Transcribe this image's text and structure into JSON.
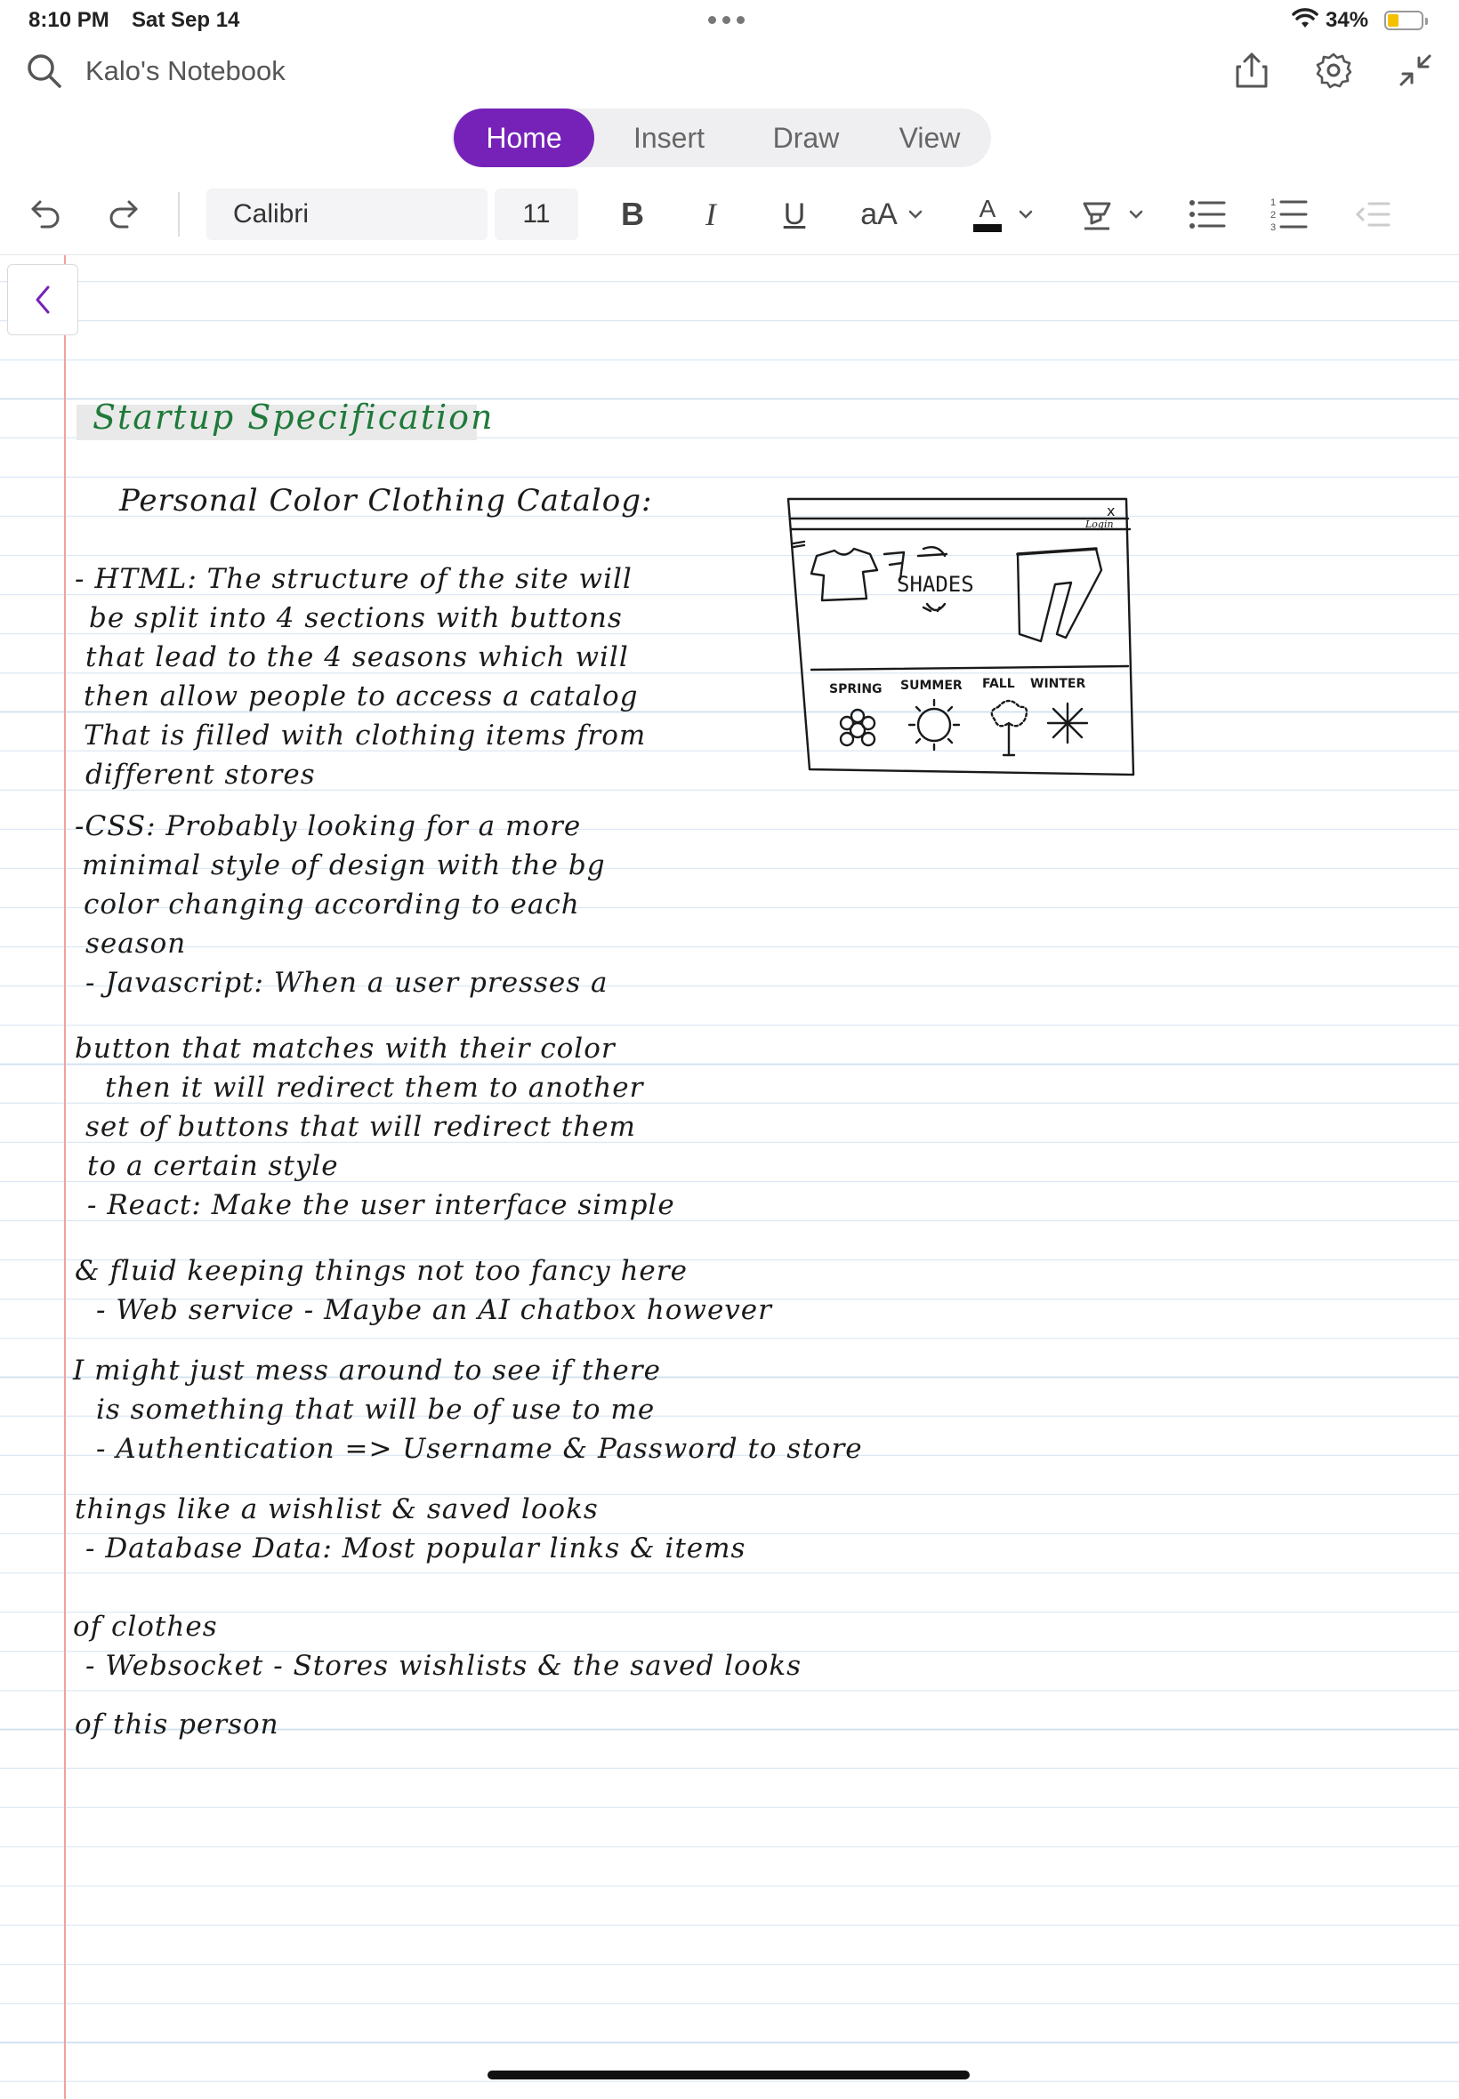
{
  "status_bar": {
    "time": "8:10 PM",
    "date": "Sat Sep 14",
    "battery": "34%"
  },
  "title_bar": {
    "notebook_name": "Kalo's Notebook"
  },
  "tabs": [
    {
      "label": "Home",
      "active": true
    },
    {
      "label": "Insert",
      "active": false
    },
    {
      "label": "Draw",
      "active": false
    },
    {
      "label": "View",
      "active": false
    }
  ],
  "toolbar": {
    "font_name": "Calibri",
    "font_size": "11",
    "bold": "B",
    "italic": "I",
    "underline": "U",
    "text_size": "aA",
    "font_color": "A"
  },
  "colors": {
    "accent": "#7622b8",
    "title_green": "#1f7a3a",
    "margin": "#f3a0a0",
    "rules": "#cfe0f0"
  },
  "note": {
    "title": "Startup Specification",
    "subtitle": "Personal Color Clothing Catalog:",
    "lines": [
      "- HTML: The structure of the site will",
      "be split into 4 sections with buttons",
      "that lead to the 4 seasons which will",
      "then allow people to access a catalog",
      "That is filled with clothing items from",
      "different stores",
      "",
      "-CSS: Probably looking for a more",
      "minimal style of design with the bg",
      "color changing according to each",
      "season",
      "",
      "- Javascript: When a user presses a",
      "button that matches with their color",
      "then it will redirect them to another",
      "set of buttons that will redirect them",
      "to a certain style",
      "",
      "- React: Make the user interface simple",
      "& fluid keeping things not too fancy here",
      "",
      "- Web service - Maybe an AI chatbox however",
      "I might just mess around to see if there",
      "is something that will be of use to me",
      "",
      "- Authentication => Username & Password to store",
      "things like a wishlist & saved looks",
      "",
      "- Database Data: Most popular links & items",
      "of clothes",
      "",
      "- Websocket - Stores wishlists & the saved looks",
      "of this person"
    ]
  },
  "sketch": {
    "login": "Login",
    "close": "x",
    "brand": "SHADES",
    "seasons": [
      "SPRING",
      "SUMMER",
      "FALL",
      "WINTER"
    ]
  }
}
